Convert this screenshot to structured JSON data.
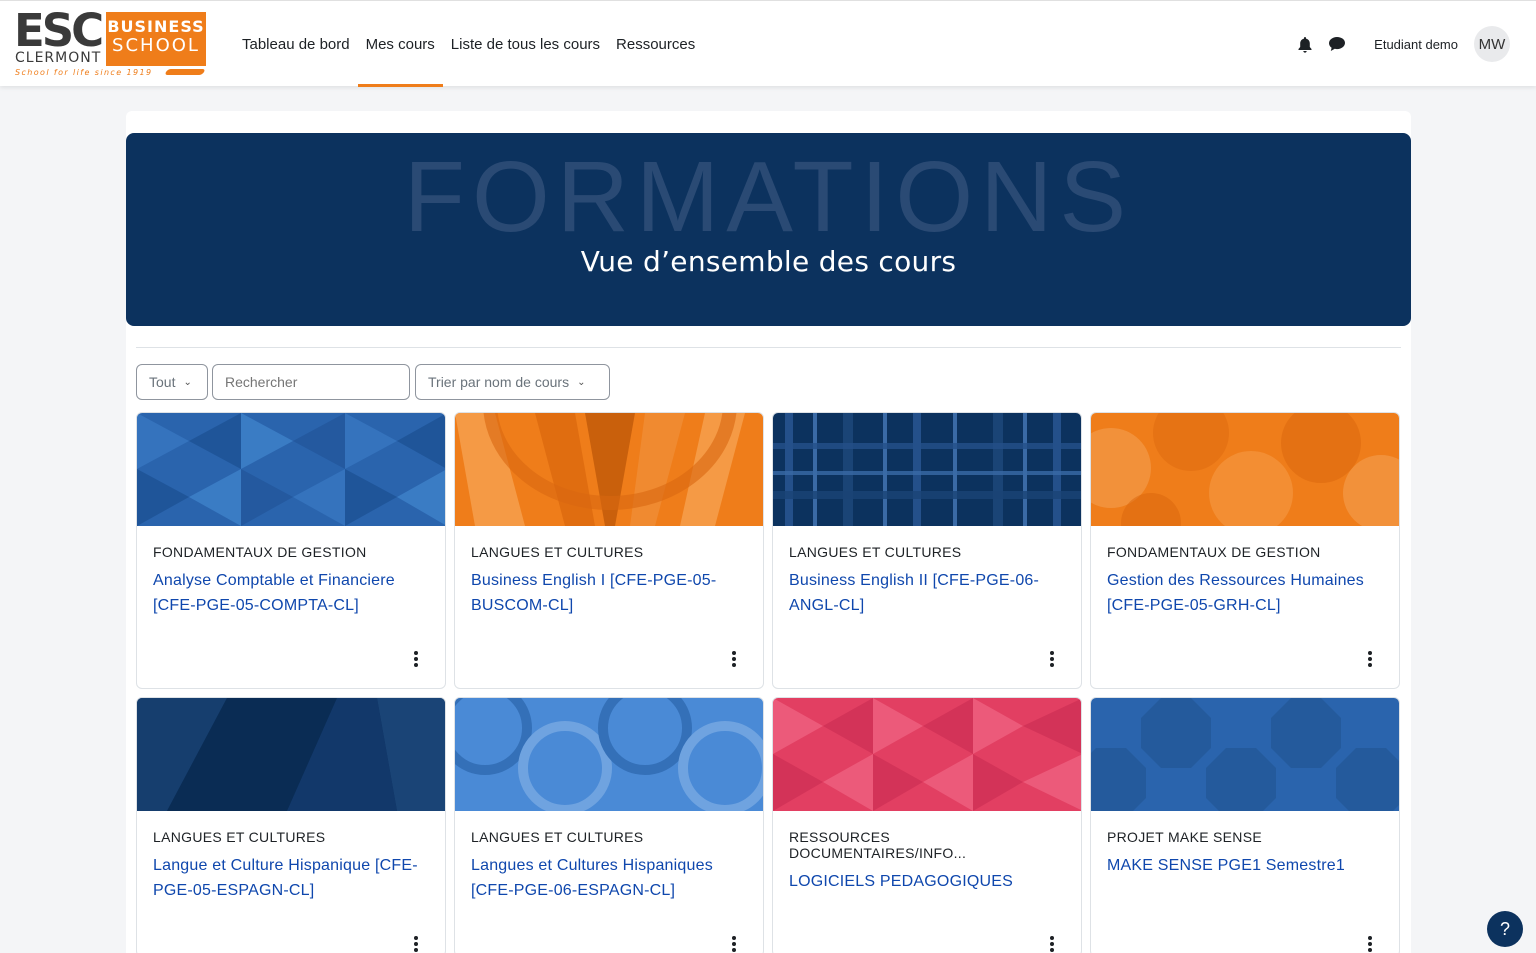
{
  "logo": {
    "esc": "ESC",
    "clermont": "CLERMONT",
    "tagline": "School for life since 1919",
    "business": "BUSINESS",
    "school": "SCHOOL"
  },
  "nav": {
    "items": [
      {
        "label": "Tableau de bord",
        "active": false
      },
      {
        "label": "Mes cours",
        "active": true
      },
      {
        "label": "Liste de tous les cours",
        "active": false
      },
      {
        "label": "Ressources",
        "active": false
      }
    ],
    "username": "Etudiant demo",
    "avatar_initials": "MW",
    "icons": [
      "bell-icon",
      "chat-icon"
    ]
  },
  "banner": {
    "title": "FORMATIONS",
    "subtitle": "Vue d’ensemble des cours",
    "color": "#0c325e"
  },
  "filters": {
    "grouping": "Tout",
    "search_placeholder": "Rechercher",
    "sort": "Trier par nom de cours"
  },
  "courses": [
    {
      "category": "FONDAMENTAUX DE GESTION",
      "title": "Analyse Comptable et Financiere [CFE-PGE-05-COMPTA-CL]",
      "pattern": "triangles",
      "color": "#2a64ad"
    },
    {
      "category": "LANGUES ET CULTURES",
      "title": "Business English I [CFE-PGE-05-BUSCOM-CL]",
      "pattern": "rays",
      "color": "#ef7d1a"
    },
    {
      "category": "LANGUES ET CULTURES",
      "title": "Business English II [CFE-PGE-06-ANGL-CL]",
      "pattern": "plaid",
      "color": "#0c325e"
    },
    {
      "category": "FONDAMENTAUX DE GESTION",
      "title": "Gestion des Ressources Humaines [CFE-PGE-05-GRH-CL]",
      "pattern": "circles",
      "color": "#ef7d1a"
    },
    {
      "category": "LANGUES ET CULTURES",
      "title": "Langue et Culture Hispanique [CFE-PGE-05-ESPAGN-CL]",
      "pattern": "facets",
      "color": "#0c325e"
    },
    {
      "category": "LANGUES ET CULTURES",
      "title": "Langues et Cultures Hispaniques [CFE-PGE-06-ESPAGN-CL]",
      "pattern": "rings",
      "color": "#4a8ad6"
    },
    {
      "category": "RESSOURCES DOCUMENTAIRES/INFO...",
      "title": "LOGICIELS PEDAGOGIQUES",
      "pattern": "triangles",
      "color": "#e23f62"
    },
    {
      "category": "PROJET MAKE SENSE",
      "title": "MAKE SENSE PGE1 Semestre1",
      "pattern": "octagons",
      "color": "#2a64ad"
    }
  ],
  "help": {
    "label": "?"
  }
}
